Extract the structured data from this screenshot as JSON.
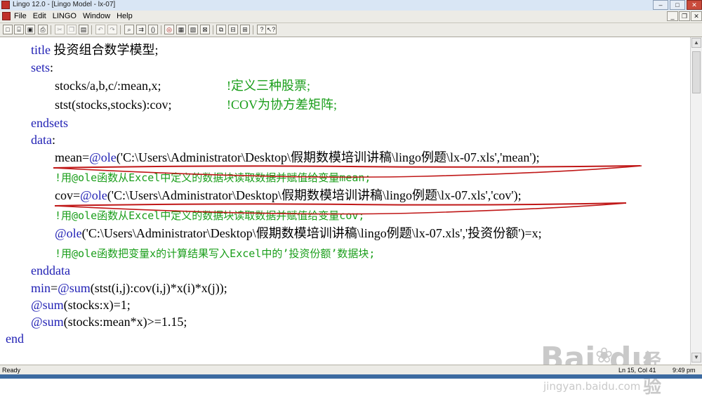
{
  "window": {
    "title": "Lingo 12.0 - [Lingo Model - lx-07]",
    "controls": {
      "minimize": "–",
      "maximize": "□",
      "close": "✕"
    },
    "mdi_controls": {
      "minimize": "_",
      "restore": "❐",
      "close": "✕"
    }
  },
  "menubar": {
    "items": [
      "File",
      "Edit",
      "LINGO",
      "Window",
      "Help"
    ]
  },
  "toolbar": {
    "buttons": [
      {
        "name": "new-icon",
        "glyph": "□"
      },
      {
        "name": "open-icon",
        "glyph": "⌸"
      },
      {
        "name": "save-icon",
        "glyph": "▣"
      },
      {
        "name": "print-icon",
        "glyph": "⎙"
      },
      {
        "name": "cut-icon",
        "glyph": "✂"
      },
      {
        "name": "copy-icon",
        "glyph": "❐"
      },
      {
        "name": "paste-icon",
        "glyph": "▤"
      },
      {
        "name": "undo-icon",
        "glyph": "↶"
      },
      {
        "name": "redo-icon",
        "glyph": "↷"
      },
      {
        "name": "find-icon",
        "glyph": "⌕"
      },
      {
        "name": "find-next-icon",
        "glyph": "⇉"
      },
      {
        "name": "match-paren-icon",
        "glyph": "()"
      },
      {
        "name": "solve-icon",
        "glyph": "◎"
      },
      {
        "name": "solution-icon",
        "glyph": "▦"
      },
      {
        "name": "matrix-picture-icon",
        "glyph": "▧"
      },
      {
        "name": "options-icon",
        "glyph": "⊠"
      },
      {
        "name": "send-to-back-icon",
        "glyph": "⧉"
      },
      {
        "name": "close-all-icon",
        "glyph": "⊟"
      },
      {
        "name": "tile-icon",
        "glyph": "⊞"
      },
      {
        "name": "help-icon",
        "glyph": "?"
      },
      {
        "name": "context-help-icon",
        "glyph": "↖?"
      }
    ]
  },
  "code": {
    "line1_kw": "title",
    "line1_text": " 投资组合数学模型;",
    "line2_kw": "sets",
    "line2_text": ":",
    "line3_code": "stocks/a,b,c/:mean,x;",
    "line3_comment": "!定义三种股票;",
    "line4_code": "stst(stocks,stocks):cov;",
    "line4_comment": "!COV为协方差矩阵;",
    "line5_kw": "endsets",
    "line6_kw": "data",
    "line6_text": ":",
    "line7_var": "mean",
    "line7_fn": "@ole",
    "line7_path": "('C:\\Users\\Administrator\\Desktop\\假期数模培训讲稿\\lingo例题\\lx-07.xls','mean');",
    "line8_comment": "!用@ole函数从Excel中定义的数据块读取数据并赋值给变量mean;",
    "line9_var": "cov",
    "line9_fn": "@ole",
    "line9_path": "('C:\\Users\\Administrator\\Desktop\\假期数模培训讲稿\\lingo例题\\lx-07.xls','cov');",
    "line10_comment": "!用@ole函数从Excel中定义的数据块读取数据并赋值给变量cov;",
    "line11_fn": "@ole",
    "line11_path": "('C:\\Users\\Administrator\\Desktop\\假期数模培训讲稿\\lingo例题\\lx-07.xls','投资份额')=x;",
    "line12_comment": "!用@ole函数把变量x的计算结果写入Excel中的’投资份额’数据块;",
    "line13_kw": "enddata",
    "line14_kw": "min",
    "line14_a": "=",
    "line14_fn": "@sum",
    "line14_text": "(stst(i,j):cov(i,j)*x(i)*x(j));",
    "line15_fn": "@sum",
    "line15_text": "(stocks:x)=1;",
    "line16_fn": "@sum",
    "line16_text": "(stocks:mean*x)>=1.15;",
    "line17_kw": "end"
  },
  "watermark": {
    "brand": "Bai",
    "brand2": "du",
    "brand_cn": "经验",
    "url": "jingyan.baidu.com"
  },
  "status": {
    "left": "Ready",
    "position": "Ln 15, Col 41",
    "time": "9:49 pm"
  },
  "colors": {
    "keyword": "#1f1fb4",
    "comment": "#1a9e1a",
    "annotation_underline": "#c01818"
  }
}
